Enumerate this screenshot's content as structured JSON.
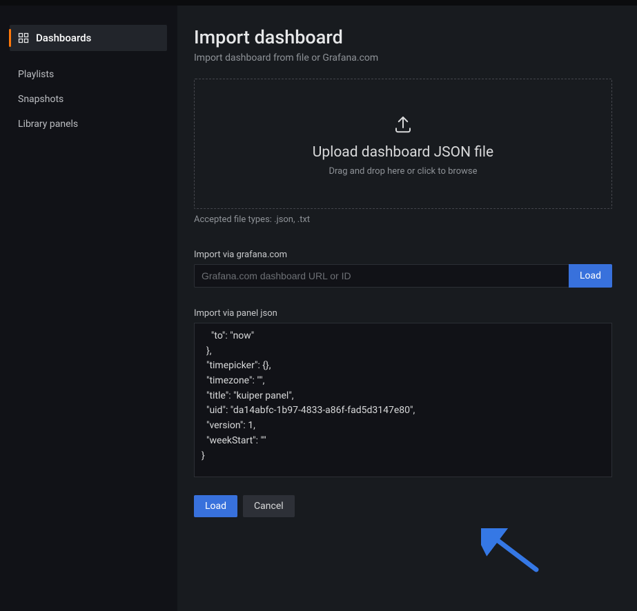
{
  "sidebar": {
    "items": [
      {
        "label": "Dashboards",
        "icon": "dashboards-icon",
        "active": true
      },
      {
        "label": "Playlists"
      },
      {
        "label": "Snapshots"
      },
      {
        "label": "Library panels"
      }
    ]
  },
  "page": {
    "title": "Import dashboard",
    "subtitle": "Import dashboard from file or Grafana.com"
  },
  "upload": {
    "heading": "Upload dashboard JSON file",
    "hint": "Drag and drop here or click to browse",
    "accepted_text": "Accepted file types: .json, .txt"
  },
  "grafana_url": {
    "label": "Import via grafana.com",
    "placeholder": "Grafana.com dashboard URL or ID",
    "load_label": "Load"
  },
  "panel_json": {
    "label": "Import via panel json",
    "content": "    \"to\": \"now\"\n  },\n  \"timepicker\": {},\n  \"timezone\": \"\",\n  \"title\": \"kuiper panel\",\n  \"uid\": \"da14abfc-1b97-4833-a86f-fad5d3147e80\",\n  \"version\": 1,\n  \"weekStart\": \"\"\n}"
  },
  "actions": {
    "load_label": "Load",
    "cancel_label": "Cancel"
  }
}
